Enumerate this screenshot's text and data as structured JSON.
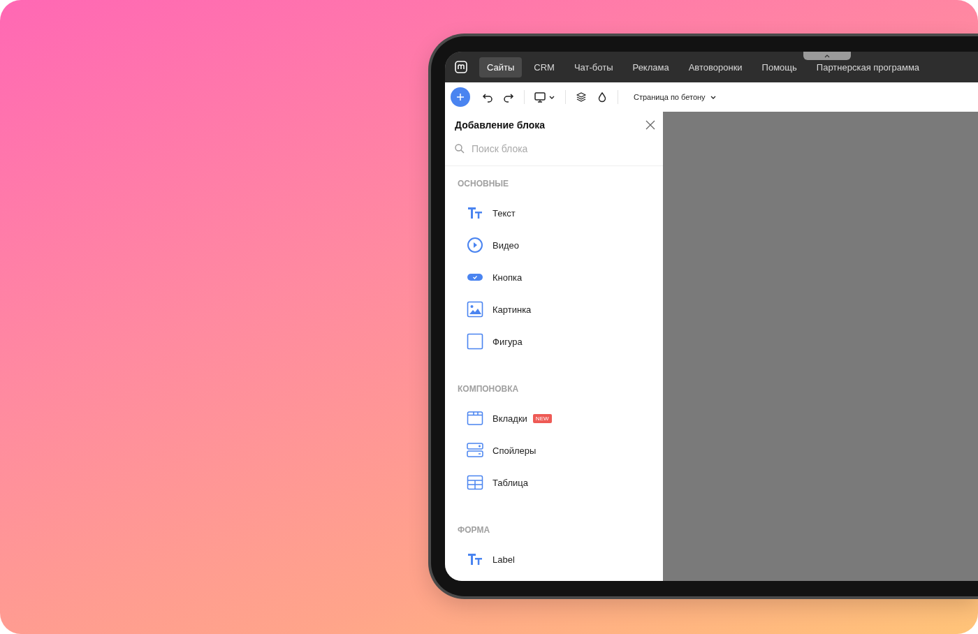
{
  "nav": {
    "tabs": [
      {
        "label": "Сайты",
        "selected": true
      },
      {
        "label": "CRM",
        "selected": false
      },
      {
        "label": "Чат-боты",
        "selected": false
      },
      {
        "label": "Реклама",
        "selected": false
      },
      {
        "label": "Автоворонки",
        "selected": false
      },
      {
        "label": "Помощь",
        "selected": false
      },
      {
        "label": "Партнерская программа",
        "selected": false
      }
    ]
  },
  "toolbar": {
    "page_selector": "Страница по бетону"
  },
  "panel": {
    "title": "Добавление блока",
    "search": {
      "placeholder": "Поиск блока"
    },
    "sections": [
      {
        "heading": "ОСНОВНЫЕ",
        "items": [
          {
            "kind": "text",
            "label": "Текст"
          },
          {
            "kind": "video",
            "label": "Видео"
          },
          {
            "kind": "button",
            "label": "Кнопка"
          },
          {
            "kind": "image",
            "label": "Картинка"
          },
          {
            "kind": "shape",
            "label": "Фигура"
          }
        ]
      },
      {
        "heading": "КОМПОНОВКА",
        "items": [
          {
            "kind": "tabs",
            "label": "Вкладки",
            "badge": "NEW"
          },
          {
            "kind": "spoilers",
            "label": "Спойлеры"
          },
          {
            "kind": "table",
            "label": "Таблица"
          }
        ]
      },
      {
        "heading": "ФОРМА",
        "items": [
          {
            "kind": "text",
            "label": "Label"
          }
        ]
      }
    ]
  }
}
